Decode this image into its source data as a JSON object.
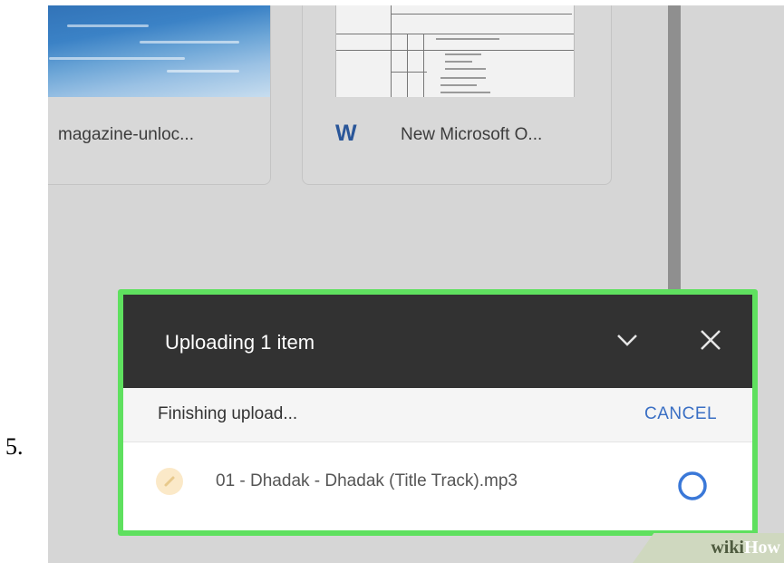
{
  "step": {
    "number": "5."
  },
  "files": [
    {
      "name": "magazine-unloc...",
      "thumb": "sky-image"
    },
    {
      "name": "New Microsoft O...",
      "thumb": "word-document",
      "type_icon": "W"
    }
  ],
  "upload_panel": {
    "title": "Uploading 1 item",
    "status": "Finishing upload...",
    "cancel_label": "CANCEL",
    "item": {
      "filename": "01 - Dhadak - Dhadak (Title Track).mp3",
      "icon": "audio-file-icon",
      "progress_icon": "circle-progress-icon"
    },
    "highlight_color": "#5fe05f",
    "header_color": "#323232",
    "accent_color": "#3a6fc4"
  },
  "watermark": {
    "part1": "wiki",
    "part2": "How"
  }
}
